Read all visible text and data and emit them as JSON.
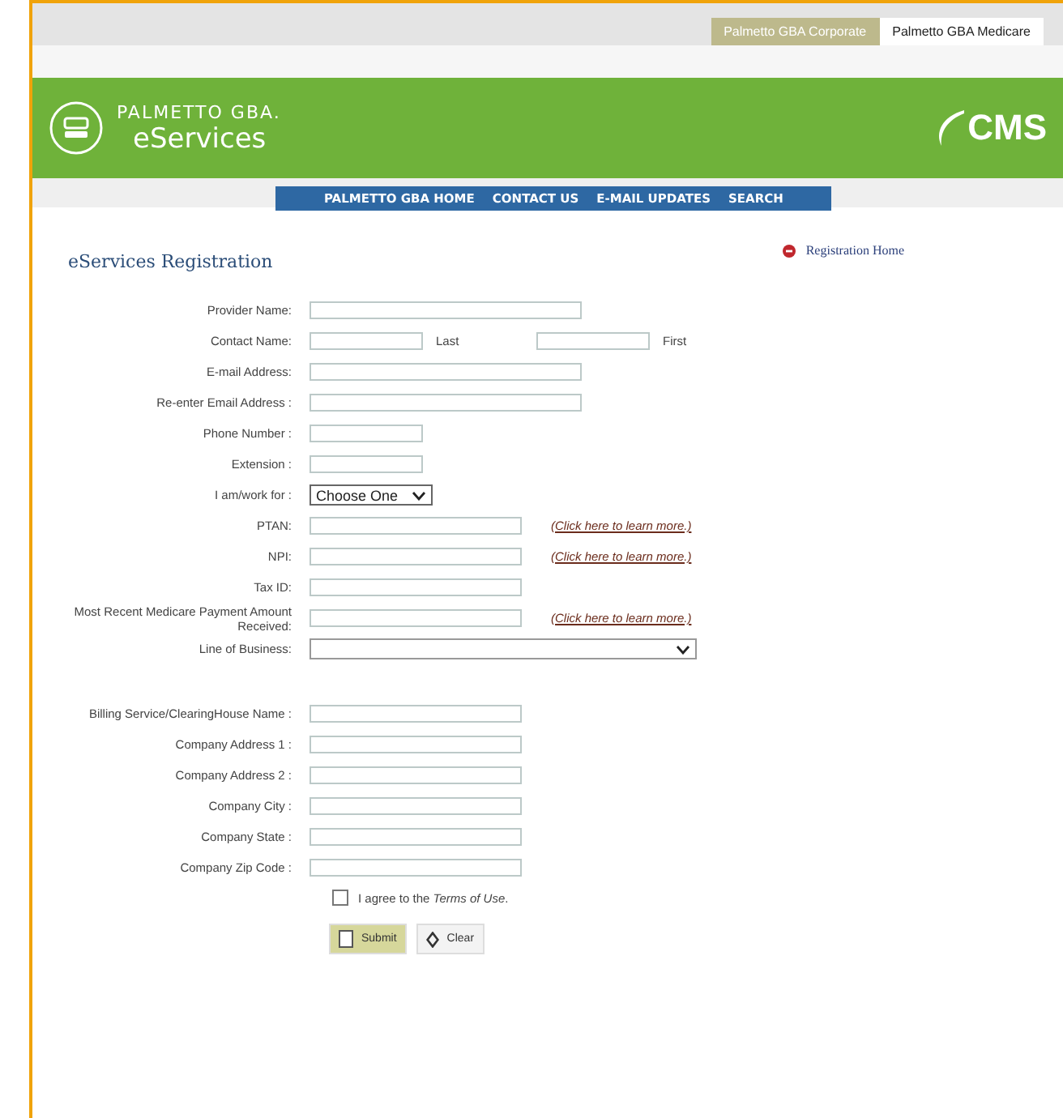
{
  "site_tabs": [
    {
      "label": "Palmetto GBA Corporate",
      "selected": false
    },
    {
      "label": "Palmetto GBA Medicare",
      "selected": true
    }
  ],
  "header": {
    "brand": "PALMETTO GBA.",
    "product": "eServices",
    "partner_logo": "CMS"
  },
  "nav": [
    "PALMETTO GBA HOME",
    "CONTACT US",
    "E-MAIL UPDATES",
    "SEARCH"
  ],
  "page_title": "eServices Registration",
  "home_link": "Registration Home",
  "form_rows": [
    {
      "kind": "wide",
      "label": "Provider Name:"
    },
    {
      "kind": "name",
      "label": "Contact Name:",
      "first_hint": "Last",
      "second_hint": "First"
    },
    {
      "kind": "wide",
      "label": "E-mail Address:"
    },
    {
      "kind": "wide",
      "label": "Re-enter Email Address :"
    },
    {
      "kind": "short",
      "label": "Phone Number :"
    },
    {
      "kind": "short",
      "label": "Extension :"
    },
    {
      "kind": "select",
      "label": "I am/work for :",
      "value": "Choose One"
    },
    {
      "kind": "medium",
      "label": "PTAN:",
      "link": "(Click here to learn more.)"
    },
    {
      "kind": "medium",
      "label": "NPI:",
      "link": "(Click here to learn more.)"
    },
    {
      "kind": "medium",
      "label": "Tax ID:"
    },
    {
      "kind": "medium",
      "label": "Most Recent Medicare Payment Amount Received:",
      "link": "(Click here to learn more.)"
    },
    {
      "kind": "dropdown",
      "label": "Line of Business:"
    },
    {
      "kind": "gap"
    },
    {
      "kind": "medium",
      "label": "Billing Service/ClearingHouse Name :"
    },
    {
      "kind": "medium",
      "label": "Company Address 1 :"
    },
    {
      "kind": "medium",
      "label": "Company Address 2 :"
    },
    {
      "kind": "medium",
      "label": "Company City :"
    },
    {
      "kind": "medium",
      "label": "Company State :"
    },
    {
      "kind": "medium",
      "label": "Company Zip Code :"
    }
  ],
  "agree": {
    "checked": false,
    "text": "I agree to the *Terms of Use*."
  },
  "buttons": [
    {
      "kind": "submit",
      "label": "Submit"
    },
    {
      "kind": "clear",
      "label": "Clear"
    }
  ]
}
